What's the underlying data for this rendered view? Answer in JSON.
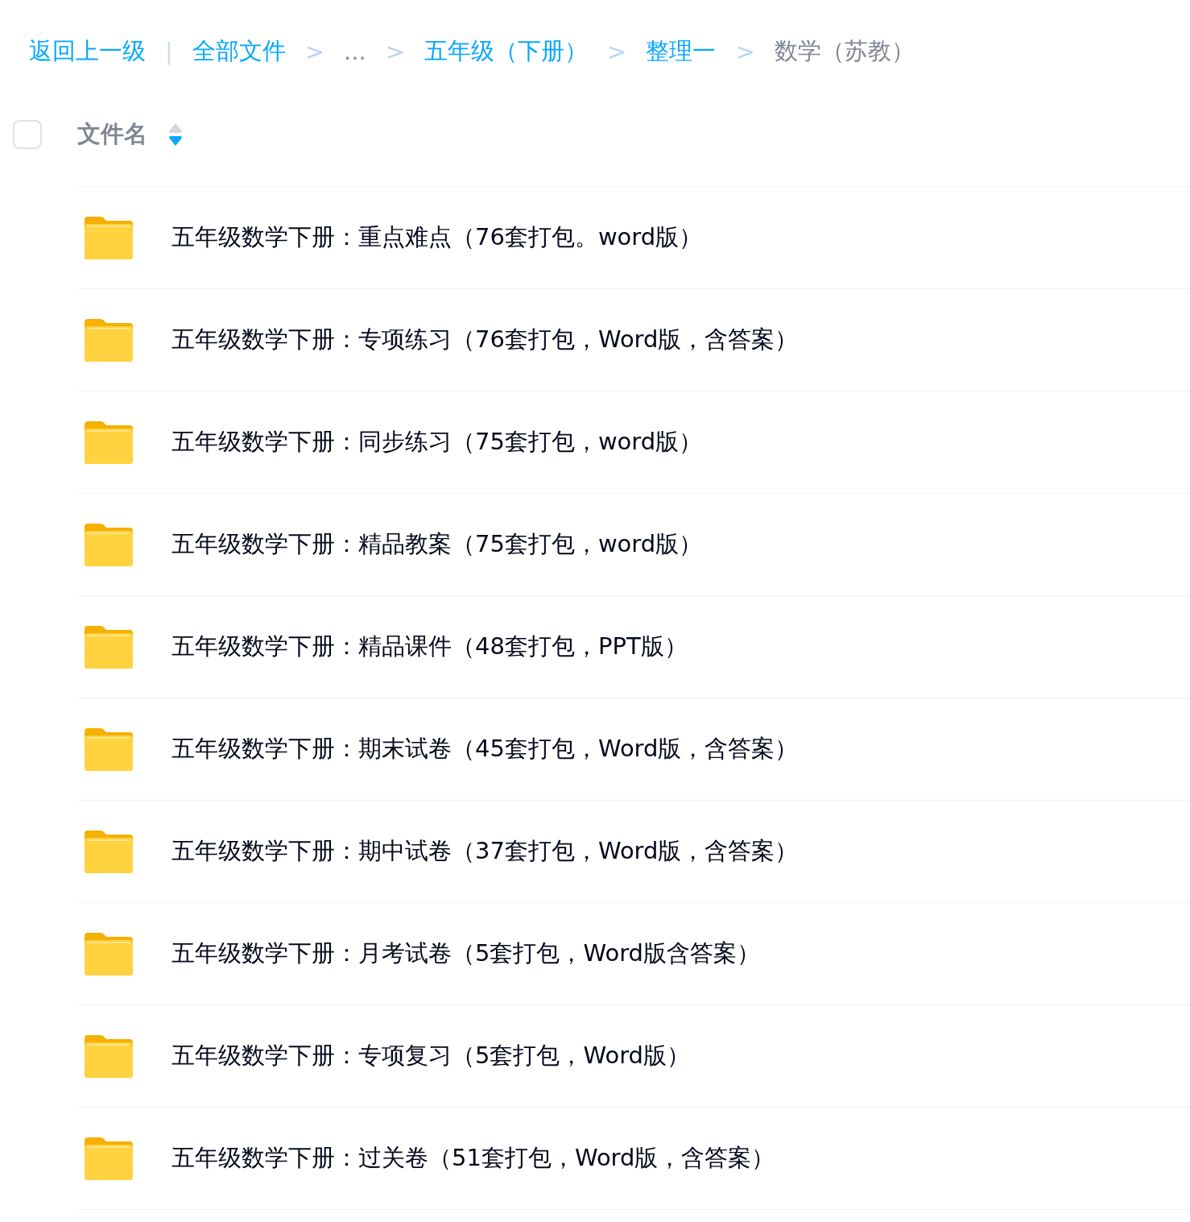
{
  "breadcrumb": [
    {
      "kind": "link",
      "text": "返回上一级"
    },
    {
      "kind": "divider",
      "text": "|"
    },
    {
      "kind": "link",
      "text": "全部文件"
    },
    {
      "kind": "separator",
      "text": ">"
    },
    {
      "kind": "ellipsis",
      "text": "..."
    },
    {
      "kind": "separator",
      "text": ">"
    },
    {
      "kind": "link",
      "text": "五年级（下册）"
    },
    {
      "kind": "separator",
      "text": ">"
    },
    {
      "kind": "link",
      "text": "整理一"
    },
    {
      "kind": "separator",
      "text": ">"
    },
    {
      "kind": "current",
      "text": "数学（苏教）"
    }
  ],
  "header": {
    "checked": false,
    "column": "文件名",
    "sort_descending": true
  },
  "files": [
    {
      "name": "五年级数学下册：重点难点（76套打包。word版）"
    },
    {
      "name": "五年级数学下册：专项练习（76套打包，Word版，含答案）"
    },
    {
      "name": "五年级数学下册：同步练习（75套打包，word版）"
    },
    {
      "name": "五年级数学下册：精品教案（75套打包，word版）"
    },
    {
      "name": "五年级数学下册：精品课件（48套打包，PPT版）"
    },
    {
      "name": "五年级数学下册：期末试卷（45套打包，Word版，含答案）"
    },
    {
      "name": "五年级数学下册：期中试卷（37套打包，Word版，含答案）"
    },
    {
      "name": "五年级数学下册：月考试卷（5套打包，Word版含答案）"
    },
    {
      "name": "五年级数学下册：专项复习（5套打包，Word版）"
    },
    {
      "name": "五年级数学下册：过关卷（51套打包，Word版，含答案）"
    }
  ]
}
